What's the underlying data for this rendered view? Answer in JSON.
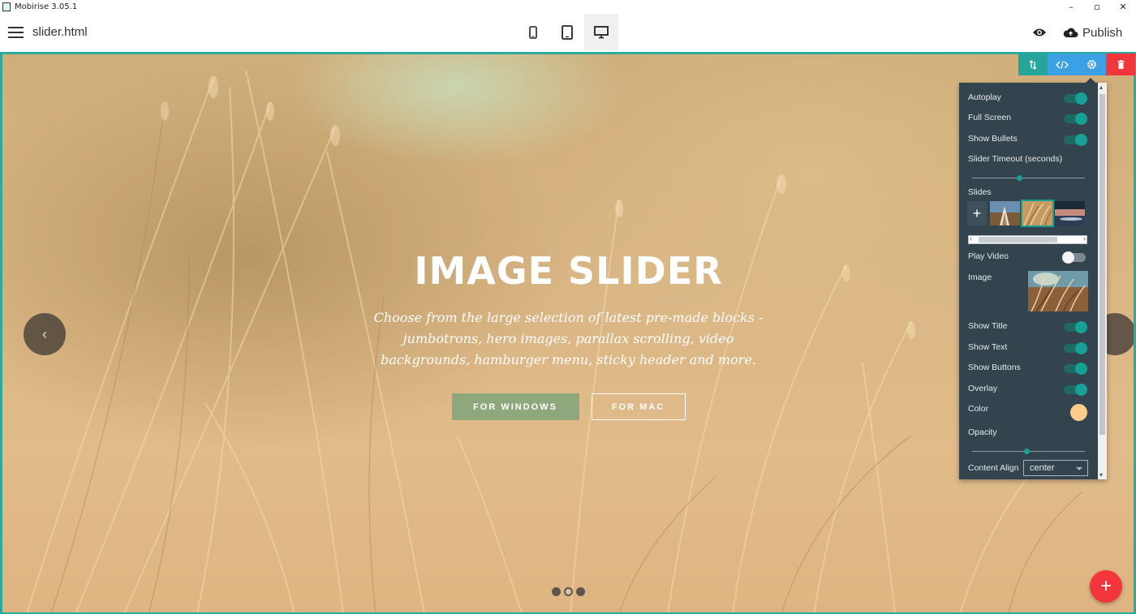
{
  "window": {
    "title": "Mobirise 3.05.1",
    "minimize": "–",
    "maximize": "▫",
    "close": "✕"
  },
  "header": {
    "file_name": "slider.html",
    "publish_label": "Publish",
    "active_device": "desktop"
  },
  "slide": {
    "title": "IMAGE SLIDER",
    "text": "Choose from the large selection of latest pre-made blocks - jumbotrons, hero images, parallax scrolling, video backgrounds, hamburger menu, sticky header and more.",
    "button_primary": "FOR WINDOWS",
    "button_secondary": "FOR MAC",
    "prev_arrow": "‹",
    "bullets": 3,
    "active_bullet": 2
  },
  "params": {
    "autoplay": {
      "label": "Autoplay",
      "on": true
    },
    "full_screen": {
      "label": "Full Screen",
      "on": true
    },
    "show_bullets": {
      "label": "Show Bullets",
      "on": true
    },
    "slider_timeout": {
      "label": "Slider Timeout (seconds)",
      "value_fraction": 0.42
    },
    "slides_label": "Slides",
    "add_slide": "+",
    "active_slide": 2,
    "play_video": {
      "label": "Play Video",
      "on": false
    },
    "image_label": "Image",
    "show_title": {
      "label": "Show Title",
      "on": true
    },
    "show_text": {
      "label": "Show Text",
      "on": true
    },
    "show_buttons": {
      "label": "Show Buttons",
      "on": true
    },
    "overlay": {
      "label": "Overlay",
      "on": true
    },
    "color": {
      "label": "Color",
      "value": "#fecb8b"
    },
    "opacity": {
      "label": "Opacity",
      "value_fraction": 0.48
    },
    "content_align": {
      "label": "Content Align",
      "value": "center"
    }
  },
  "colors": {
    "accent": "#2bab9b",
    "toolbar_move": "#26a69a",
    "toolbar_code": "#3ba1e4",
    "toolbar_settings": "#3ba1e4",
    "toolbar_delete": "#f2363b",
    "fab": "#f2363b"
  },
  "icons": {
    "menu": "hamburger-icon",
    "phone": "phone-icon",
    "tablet": "tablet-icon",
    "desktop": "desktop-icon",
    "preview": "eye-icon",
    "publish": "cloud-upload-icon",
    "move": "move-icon",
    "code": "code-icon",
    "settings": "gear-icon",
    "delete": "trash-icon",
    "fab": "plus-icon"
  },
  "fab_label": "+"
}
